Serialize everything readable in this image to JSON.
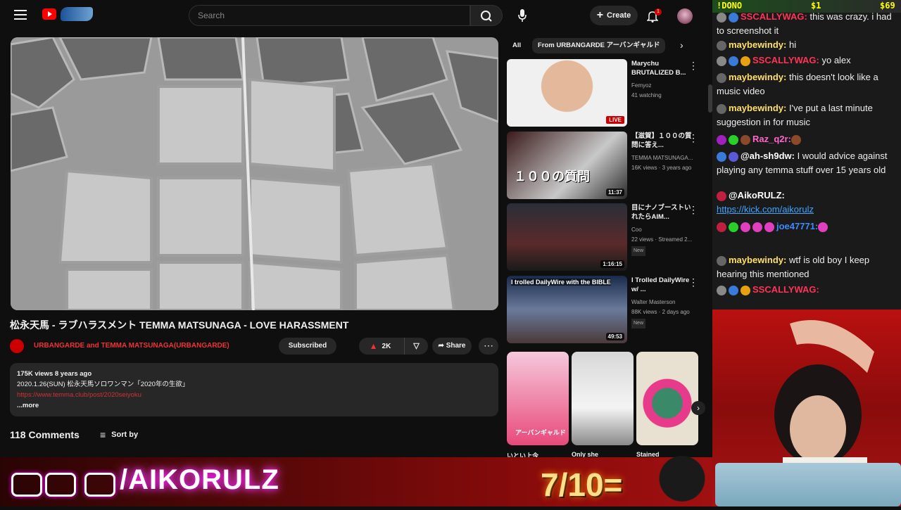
{
  "search": {
    "placeholder": "Search"
  },
  "header": {
    "create_label": "Create",
    "notif_count": "1"
  },
  "video": {
    "title": "松永天馬 - ラブハラスメント TEMMA MATSUNAGA - LOVE HARASSMENT",
    "channel": "URBANGARDE and TEMMA MATSUNAGA(URBANGARDE)",
    "subscribed_label": "Subscribed",
    "likes": "2K",
    "share_label": "Share",
    "views": "175K views  8 years ago",
    "desc_line": "2020.1.26(SUN) 松永天馬ソロワンマン「2020年の生欲」",
    "desc_link": "https://www.temma.club/post/2020seiyoku",
    "more": "...more",
    "comments": "118 Comments",
    "sort_label": "Sort by"
  },
  "chips": [
    "All",
    "From URBANGARDE アーバンギャルド"
  ],
  "recs": [
    {
      "title": "Marychu BRUTALIZED B...",
      "channel": "Femyoz",
      "stats": "41 watching",
      "badge": "LIVE",
      "dur": ""
    },
    {
      "title": "【滋賀】１００の質問に答え...",
      "channel": "TEMMA MATSUNAGA...",
      "stats": "16K views · 3 years ago",
      "badge": "",
      "dur": "11:37"
    },
    {
      "title": "目にナノブーストいれたらAIM...",
      "channel": "Coo",
      "stats": "22 views · Streamed 2...",
      "badge": "New",
      "dur": "1:16:15"
    },
    {
      "title": "I Trolled DailyWire w/ ...",
      "channel": "Walter Masterson",
      "stats": "88K views · 2 days ago",
      "badge": "New",
      "dur": "49:53"
    }
  ],
  "rec_thumb_text": {
    "trolled": "I trolled DailyWire with the BIBLE",
    "shiga": "１００の質問"
  },
  "shorts": [
    "いとい上今",
    "Only she",
    "Stained"
  ],
  "shorts_thumb": "アーバンギャルド",
  "chat": {
    "top_left": "!DONO",
    "top_mid": "$1",
    "top_right": "$69",
    "messages": [
      {
        "user": "SSCALLYWAG:",
        "text": " this was crazy. i had to screenshot it"
      },
      {
        "user": "maybewindy:",
        "text": " hi"
      },
      {
        "user": "SSCALLYWAG:",
        "text": " yo alex"
      },
      {
        "user": "maybewindy:",
        "text": " this doesn't look like a music video"
      },
      {
        "user": "maybewindy:",
        "text": " I've put a last minute suggestion in for music"
      },
      {
        "user": "Raz_q2r:",
        "text": ""
      },
      {
        "user": "@ah-sh9dw:",
        "text": " I would advice against playing any temma stuff over 15 years old"
      },
      {
        "user": "@AikoRULZ:",
        "text": "",
        "link": "https://kick.com/aikorulz"
      },
      {
        "user": "joe47771:",
        "text": ""
      },
      {
        "user": "maybewindy:",
        "text": " wtf is old boy I keep hearing this mentioned"
      },
      {
        "user": "SSCALLYWAG:",
        "text": ""
      }
    ]
  },
  "overlay": {
    "handle": "/AIKORULZ",
    "rating": "7/10="
  },
  "colors": {
    "accent": "#ff0000",
    "link": "#3ea6ff",
    "overlay_red": "#8a0b0b"
  }
}
